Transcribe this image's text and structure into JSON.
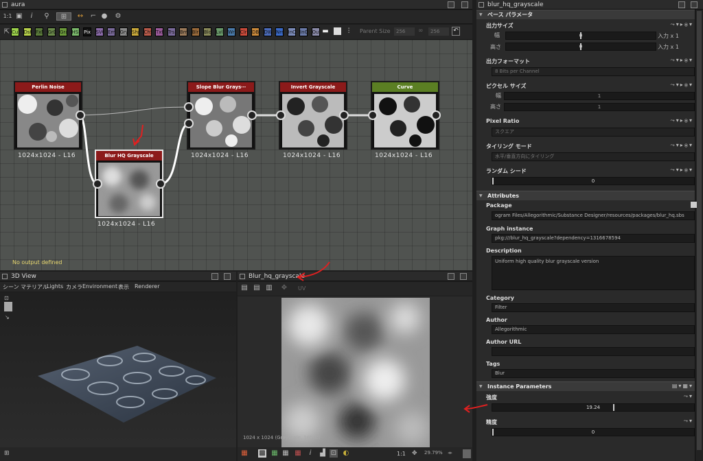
{
  "graph_window": {
    "title": "aura"
  },
  "graph_toolbar": {
    "zoom": "1:1",
    "parent_size_label": "Parent Size",
    "parent_w": "256",
    "parent_h": "256"
  },
  "chips": [
    {
      "label": "Cur",
      "color": "#9bd04a"
    },
    {
      "label": "Dst",
      "color": "#b6d04a"
    },
    {
      "label": "FxM",
      "color": "#5a7a3a"
    },
    {
      "label": "GrD",
      "color": "#6a8a4a"
    },
    {
      "label": "Gra",
      "color": "#6b9a3a"
    },
    {
      "label": "HSL",
      "color": "#7ab86a"
    },
    {
      "label": "Pix",
      "color": "#111111"
    },
    {
      "label": "SVG",
      "color": "#8a6aa8"
    },
    {
      "label": "Emb",
      "color": "#7a6a9a"
    },
    {
      "label": "Gry",
      "color": "#8a8a8a"
    },
    {
      "label": "Shp",
      "color": "#c8a83a"
    },
    {
      "label": "ChS",
      "color": "#b85a4a"
    },
    {
      "label": "Txt",
      "color": "#9a5a9a"
    },
    {
      "label": "Trs",
      "color": "#7a6a9a"
    },
    {
      "label": "Bmp",
      "color": "#9a7a5a"
    },
    {
      "label": "Blr",
      "color": "#9a6a3a"
    },
    {
      "label": "Bld",
      "color": "#8a8a5a"
    },
    {
      "label": "Lvl",
      "color": "#6a9a6a"
    },
    {
      "label": "Wrp",
      "color": "#4a7aaa"
    },
    {
      "label": "Clr",
      "color": "#c84a3a"
    },
    {
      "label": "DBl",
      "color": "#c8883a"
    },
    {
      "label": "DWr",
      "color": "#4a6ab8"
    },
    {
      "label": "Nrm",
      "color": "#3a6ac8"
    },
    {
      "label": "InC",
      "color": "#7a8ab8"
    },
    {
      "label": "InG",
      "color": "#6a7aa8"
    },
    {
      "label": "Out",
      "color": "#8a8aa8"
    }
  ],
  "nodes": {
    "perlin": {
      "title": "Perlin Noise",
      "size": "1024x1024 - L16"
    },
    "blur": {
      "title": "Blur HQ Grayscale",
      "size": "1024x1024 - L16"
    },
    "slope": {
      "title": "Slope Blur Grays⋯",
      "size": "1024x1024 - L16"
    },
    "invert": {
      "title": "Invert Grayscale",
      "size": "1024x1024 - L16"
    },
    "curve": {
      "title": "Curve",
      "size": "1024x1024 - L16"
    }
  },
  "graph_status": "No output defined",
  "view3d": {
    "title": "3D View",
    "menu": [
      "シーン",
      "マテリアル",
      "Lights",
      "カメラ",
      "Environment",
      "表示",
      "Renderer"
    ]
  },
  "view2d": {
    "title": "Blur_hq_grayscale",
    "uv": "UV",
    "info": "1024 x 1024 (Grayscale, 16bpc)",
    "zoom": "29.79%",
    "ratio": "1:1"
  },
  "props": {
    "title": "blur_hq_grayscale",
    "base_section": "ベース パラメータ",
    "output_size": {
      "label": "出力サイズ",
      "width_label": "幅",
      "height_label": "高さ",
      "width_value": "0",
      "height_value": "0",
      "width_unit": "入力 x 1",
      "height_unit": "入力 x 1"
    },
    "output_format": {
      "label": "出力フォーマット",
      "value": "8 Bits per Channel"
    },
    "pixel_size": {
      "label": "ピクセル サイズ",
      "w_label": "幅",
      "h_label": "高さ",
      "w_value": "1",
      "h_value": "1"
    },
    "pixel_ratio": {
      "label": "Pixel Ratio",
      "value": "スクエア"
    },
    "tiling": {
      "label": "タイリング モード",
      "value": "水平/垂直方向にタイリング"
    },
    "random_seed": {
      "label": "ランダム シード",
      "value": "0"
    },
    "attributes_section": "Attributes",
    "package": {
      "label": "Package",
      "value": "ogram Files/Allegorithmic/Substance Designer/resources/packages/blur_hq.sbs"
    },
    "graph_instance": {
      "label": "Graph instance",
      "value": "pkg:///blur_hq_grayscale?dependency=1316678594"
    },
    "description": {
      "label": "Description",
      "value": "Uniform high quality blur grayscale version"
    },
    "category": {
      "label": "Category",
      "value": "Filter"
    },
    "author": {
      "label": "Author",
      "value": "Allegorithmic"
    },
    "author_url": {
      "label": "Author URL",
      "value": ""
    },
    "tags": {
      "label": "Tags",
      "value": "Blur"
    },
    "instance_section": "Instance Parameters",
    "intensity": {
      "label": "強度",
      "value": "19.24",
      "fill": 0.6
    },
    "quality": {
      "label": "精度",
      "value": "0"
    }
  }
}
